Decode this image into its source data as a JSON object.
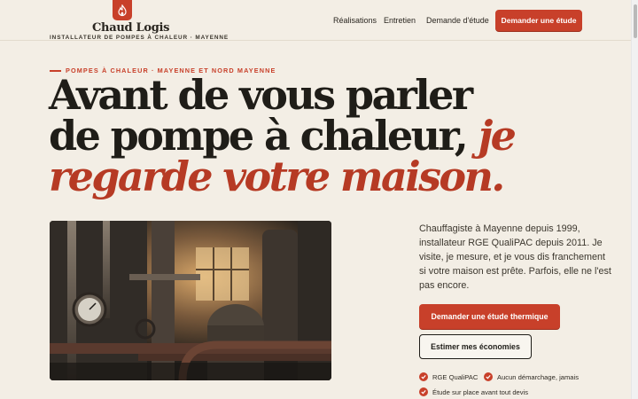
{
  "brand": {
    "name": "Chaud Logis",
    "tagline": "INSTALLATEUR DE POMPES À CHALEUR · MAYENNE",
    "logo_icon": "heat-flame-icon",
    "accent_color": "#c8402a"
  },
  "nav": {
    "links": [
      "Réalisations",
      "Entretien",
      "Demande d'étude"
    ],
    "cta": "Demander une étude"
  },
  "hero": {
    "eyebrow": "POMPES À CHALEUR · MAYENNE ET NORD MAYENNE",
    "headline_line1": "Avant de vous parler",
    "headline_line2": "de pompe à chaleur,",
    "headline_accent_inline": "je",
    "headline_accent_line3": "regarde votre maison.",
    "image_icon": "boiler-room-photo",
    "intro": "Chauffagiste à Mayenne depuis 1999, installateur RGE QualiPAC depuis 2011. Je visite, je mesure, et je vous dis franchement si votre maison est prête. Parfois, elle ne l'est pas encore.",
    "primary_cta": "Demander une étude thermique",
    "secondary_cta": "Estimer mes économies",
    "badges": [
      "RGE QualiPAC",
      "Aucun démarchage, jamais",
      "Étude sur place avant tout devis"
    ]
  }
}
